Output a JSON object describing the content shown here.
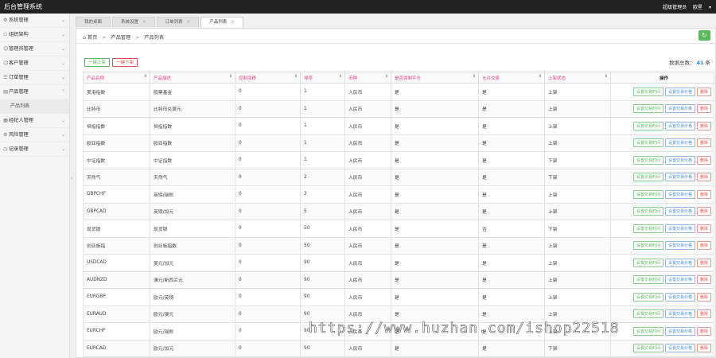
{
  "topbar": {
    "title": "后台管理系统",
    "user_role": "超级管理员",
    "user_name": "欧星"
  },
  "sidebar": {
    "items": [
      {
        "label": "系统管理",
        "icon": "gear-icon"
      },
      {
        "label": "组织架构",
        "icon": "org-icon"
      },
      {
        "label": "管理员管理",
        "icon": "user-icon"
      },
      {
        "label": "客户管理",
        "icon": "user-icon"
      },
      {
        "label": "订单管理",
        "icon": "list-icon"
      },
      {
        "label": "产品管理",
        "icon": "doc-icon"
      }
    ],
    "sub_items": [
      {
        "label": "产品列表"
      }
    ],
    "items2": [
      {
        "label": "经纪人管理",
        "icon": "grid-icon"
      },
      {
        "label": "风险管理",
        "icon": "gear-icon"
      },
      {
        "label": "记录管理",
        "icon": "clock-icon"
      }
    ]
  },
  "tabs": [
    {
      "label": "我的桌面"
    },
    {
      "label": "系统设置"
    },
    {
      "label": "订单列表"
    },
    {
      "label": "产品列表"
    }
  ],
  "breadcrumb": {
    "home": "首页",
    "section": "产品管理",
    "page": "产品列表"
  },
  "actions": {
    "batch_up": "一键上架",
    "batch_down": "一键下架"
  },
  "summary": {
    "label": "数据总数：",
    "count": "41",
    "unit": "条"
  },
  "table": {
    "headers": [
      "产品名称",
      "产品描述",
      "控制涨跌",
      "排序",
      "币种",
      "是否强制平仓",
      "允许交易",
      "上架状态",
      "操作"
    ],
    "op_labels": {
      "time": "设置交易时间",
      "price": "设置交易价格",
      "delete": "删除"
    },
    "rows": [
      [
        "美港指数",
        "股票基金",
        "0",
        "1",
        "人民币",
        "是",
        "是",
        "上架"
      ],
      [
        "比特币",
        "比特币兑美元",
        "0",
        "1",
        "人民币",
        "是",
        "是",
        "上架"
      ],
      [
        "恒指指数",
        "恒指指数",
        "0",
        "1",
        "人民币",
        "是",
        "是",
        "上架"
      ],
      [
        "欧亚指数",
        "欧亚指数",
        "0",
        "1",
        "人民币",
        "是",
        "是",
        "上架"
      ],
      [
        "中证指数",
        "中证指数",
        "0",
        "1",
        "人民币",
        "是",
        "是",
        "下架"
      ],
      [
        "天然气",
        "天然气",
        "0",
        "2",
        "人民币",
        "是",
        "是",
        "下架"
      ],
      [
        "GBPCHF",
        "英镑/瑞郎",
        "0",
        "3",
        "人民币",
        "是",
        "是",
        "上架"
      ],
      [
        "GBPCAD",
        "英镑/加元",
        "0",
        "5",
        "人民币",
        "是",
        "是",
        "上架"
      ],
      [
        "现货银",
        "现货银",
        "0",
        "50",
        "人民币",
        "是",
        "否",
        "下架"
      ],
      [
        "创业板指",
        "创业板指数",
        "0",
        "50",
        "人民币",
        "是",
        "是",
        "上架"
      ],
      [
        "USDCAD",
        "美元/加元",
        "0",
        "90",
        "人民币",
        "是",
        "是",
        "上架"
      ],
      [
        "AUDNZD",
        "澳元/新西兰元",
        "0",
        "90",
        "人民币",
        "是",
        "是",
        "上架"
      ],
      [
        "EURGBP",
        "欧元/英镑",
        "0",
        "90",
        "人民币",
        "是",
        "是",
        "上架"
      ],
      [
        "EURAUD",
        "欧元/澳元",
        "0",
        "90",
        "人民币",
        "是",
        "是",
        "上架"
      ],
      [
        "EURCHF",
        "欧元/瑞郎",
        "0",
        "90",
        "人民币",
        "是",
        "是",
        "上架"
      ],
      [
        "EURCAD",
        "欧元/加元",
        "0",
        "90",
        "人民币",
        "是",
        "是",
        "下架"
      ]
    ]
  },
  "watermark": "https://www.huzhan.com/ishop22518",
  "colors": {
    "accent_green": "#5cb85c",
    "accent_blue": "#4a90d9",
    "accent_red": "#d9534f",
    "header_pink": "#e83e8c",
    "topbar": "#222222"
  }
}
